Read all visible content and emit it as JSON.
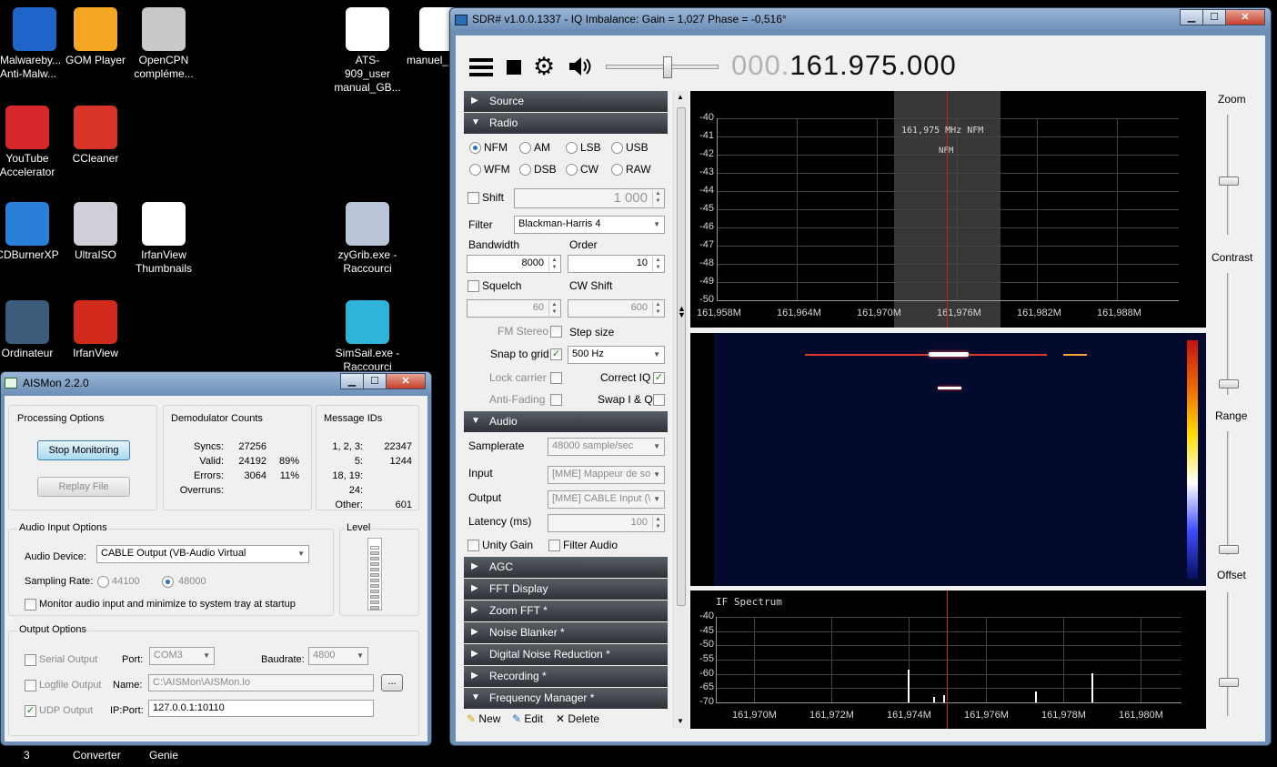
{
  "desktop": {
    "icons": [
      {
        "id": "malwarebytes",
        "label": "Malwareby... Anti-Malw...",
        "color": "#1f65c9"
      },
      {
        "id": "gom",
        "label": "GOM Player",
        "color": "#f5a623"
      },
      {
        "id": "opencpn",
        "label": "OpenCPN compléme...",
        "color": "#c8c8c8"
      },
      {
        "id": "ats909",
        "label": "ATS-909_user manual_GB...",
        "color": "#ffffff"
      },
      {
        "id": "manuel",
        "label": "manuel_",
        "color": "#ffffff"
      },
      {
        "id": "youtube",
        "label": "YouTube Accelerator",
        "color": "#d6272b"
      },
      {
        "id": "ccleaner",
        "label": "CCleaner",
        "color": "#d9342a"
      },
      {
        "id": "cdburner",
        "label": "CDBurnerXP",
        "color": "#2a7fd8"
      },
      {
        "id": "ultraiso",
        "label": "UltraISO",
        "color": "#cfcfd8"
      },
      {
        "id": "irfanthumbs",
        "label": "IrfanView Thumbnails",
        "color": "#ffffff"
      },
      {
        "id": "zygrib",
        "label": "zyGrib.exe - Raccourci",
        "color": "#b9c4d6"
      },
      {
        "id": "ordinateur",
        "label": "Ordinateur",
        "color": "#3b5b7a"
      },
      {
        "id": "irfanview",
        "label": "IrfanView",
        "color": "#d12a1c"
      },
      {
        "id": "simsail",
        "label": "SimSail.exe - Raccourci",
        "color": "#2fb3d9"
      }
    ]
  },
  "taskbar": {
    "items": [
      "3",
      "Converter",
      "Genie"
    ]
  },
  "aismon": {
    "title": "AISMon 2.2.0",
    "processing": {
      "legend": "Processing Options",
      "stop_label": "Stop Monitoring",
      "replay_label": "Replay File"
    },
    "demod": {
      "legend": "Demodulator Counts",
      "rows": [
        {
          "label": "Syncs:",
          "value": "27256",
          "pct": ""
        },
        {
          "label": "Valid:",
          "value": "24192",
          "pct": "89%"
        },
        {
          "label": "Errors:",
          "value": "3064",
          "pct": "11%"
        },
        {
          "label": "Overruns:",
          "value": "",
          "pct": ""
        }
      ]
    },
    "msgids": {
      "legend": "Message IDs",
      "rows": [
        {
          "label": "1, 2, 3:",
          "value": "22347"
        },
        {
          "label": "5:",
          "value": "1244"
        },
        {
          "label": "18, 19:",
          "value": ""
        },
        {
          "label": "24:",
          "value": ""
        },
        {
          "label": "Other:",
          "value": "601"
        }
      ]
    },
    "audio": {
      "legend": "Audio Input Options",
      "device_label": "Audio Device:",
      "device_value": "CABLE Output (VB-Audio Virtual",
      "rate_label": "Sampling Rate:",
      "rate_a": "44100",
      "rate_b": "48000",
      "monitor_label": "Monitor audio input and minimize to system tray at startup"
    },
    "level": {
      "legend": "Level",
      "fraction": 0.9
    },
    "output": {
      "legend": "Output Options",
      "serial_label": "Serial Output",
      "port_label": "Port:",
      "port_value": "COM3",
      "baud_label": "Baudrate:",
      "baud_value": "4800",
      "logfile_label": "Logfile Output",
      "name_label": "Name:",
      "name_value": "C:\\AISMon\\AISMon.lo",
      "browse_label": "...",
      "udp_label": "UDP Output",
      "ipport_label": "IP:Port:",
      "ipport_value": "127.0.0.1:10110"
    }
  },
  "sdr": {
    "title": "SDR# v1.0.0.1337 - IQ Imbalance: Gain = 1,027 Phase = -0,516°",
    "freq_dim": "000.",
    "freq_main": "161.975.000",
    "volume_fraction": 0.55,
    "sections": {
      "source": "Source",
      "radio": "Radio",
      "audio": "Audio",
      "agc": "AGC",
      "fft": "FFT Display",
      "zoomfft": "Zoom FFT *",
      "noise": "Noise Blanker *",
      "dnr": "Digital Noise Reduction *",
      "recording": "Recording *",
      "freqmgr": "Frequency Manager *"
    },
    "radio": {
      "modes": [
        "NFM",
        "AM",
        "LSB",
        "USB",
        "WFM",
        "DSB",
        "CW",
        "RAW"
      ],
      "selected": "NFM",
      "shift_label": "Shift",
      "shift_value": "1 000",
      "filter_label": "Filter",
      "filter_value": "Blackman-Harris 4",
      "bandwidth_label": "Bandwidth",
      "bandwidth_value": "8000",
      "order_label": "Order",
      "order_value": "10",
      "squelch_label": "Squelch",
      "squelch_value": "60",
      "cwshift_label": "CW Shift",
      "cwshift_value": "600",
      "fmstereo_label": "FM Stereo",
      "stepsize_label": "Step size",
      "snap_label": "Snap to grid",
      "step_value": "500 Hz",
      "lock_label": "Lock carrier",
      "correctiq_label": "Correct IQ",
      "antifading_label": "Anti-Fading",
      "swapiq_label": "Swap I & Q"
    },
    "audio": {
      "samplerate_label": "Samplerate",
      "samplerate_value": "48000 sample/sec",
      "input_label": "Input",
      "input_value": "[MME] Mappeur de so",
      "output_label": "Output",
      "output_value": "[MME] CABLE Input (\\",
      "latency_label": "Latency (ms)",
      "latency_value": "100",
      "unity_label": "Unity Gain",
      "filteraudio_label": "Filter Audio"
    },
    "freqmgr": {
      "new_label": "New",
      "edit_label": "Edit",
      "delete_label": "Delete"
    },
    "right": {
      "zoom": "Zoom",
      "contrast": "Contrast",
      "range": "Range",
      "offset": "Offset"
    },
    "spectrum": {
      "center_label": "161,975 MHz  NFM",
      "mode_label": "NFM",
      "y_ticks": [
        "-40",
        "-41",
        "-42",
        "-43",
        "-44",
        "-45",
        "-46",
        "-47",
        "-48",
        "-49",
        "-50"
      ],
      "x_ticks": [
        "161,958M",
        "161,964M",
        "161,970M",
        "161,976M",
        "161,982M",
        "161,988M"
      ]
    },
    "ifspectrum": {
      "title": "IF Spectrum",
      "y_ticks": [
        "-40",
        "-45",
        "-50",
        "-55",
        "-60",
        "-65",
        "-70"
      ],
      "x_ticks": [
        "161,970M",
        "161,972M",
        "161,974M",
        "161,976M",
        "161,978M",
        "161,980M"
      ]
    }
  }
}
